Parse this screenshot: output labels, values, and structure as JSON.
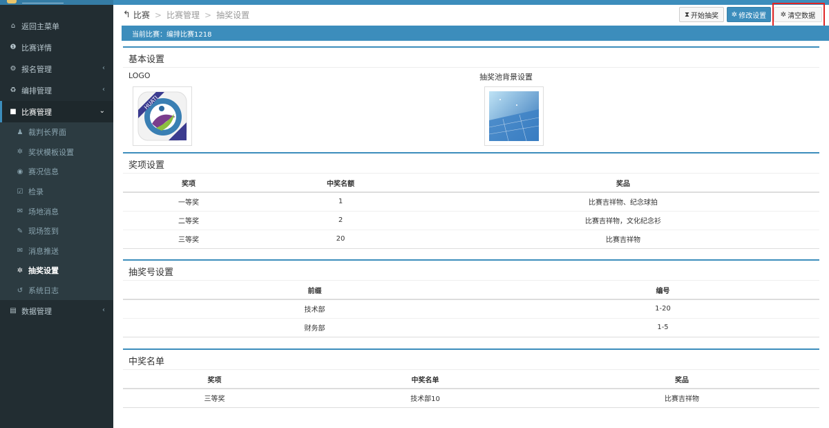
{
  "sidebar": {
    "items": [
      {
        "label": "返回主菜单",
        "icon": "home-icon",
        "glyph": "⌂"
      },
      {
        "label": "比赛详情",
        "icon": "info-icon",
        "glyph": "❶"
      },
      {
        "label": "报名管理",
        "icon": "cogs-icon",
        "glyph": "⚙"
      },
      {
        "label": "编排管理",
        "icon": "recycle-icon",
        "glyph": "♻"
      },
      {
        "label": "比赛管理",
        "icon": "square-icon",
        "glyph": "■"
      }
    ],
    "sub_items": [
      {
        "label": "裁判长界面",
        "icon": "user-icon",
        "glyph": "♟"
      },
      {
        "label": "奖状模板设置",
        "icon": "gear-icon",
        "glyph": "✲"
      },
      {
        "label": "赛况信息",
        "icon": "eye-icon",
        "glyph": "◉"
      },
      {
        "label": "检录",
        "icon": "checkbox-icon",
        "glyph": "☑"
      },
      {
        "label": "场地消息",
        "icon": "comments-icon",
        "glyph": "✉"
      },
      {
        "label": "现场签到",
        "icon": "edit-icon",
        "glyph": "✎"
      },
      {
        "label": "消息推送",
        "icon": "comments-icon",
        "glyph": "✉"
      },
      {
        "label": "抽奖设置",
        "icon": "gear-icon",
        "glyph": "✲"
      },
      {
        "label": "系统日志",
        "icon": "history-icon",
        "glyph": "↺"
      }
    ],
    "last_item": {
      "label": "数据管理",
      "icon": "database-icon",
      "glyph": "▤"
    }
  },
  "breadcrumb": {
    "root": "比赛",
    "middle": "比赛管理",
    "current": "抽奖设置"
  },
  "toolbar": {
    "start": "开始抽奖",
    "modify": "修改设置",
    "clear": "清空数据"
  },
  "banner": "当前比赛：编排比赛1218",
  "basic": {
    "title": "基本设置",
    "logo_label": "LOGO",
    "logo_text": "HUATI",
    "bg_label": "抽奖池背景设置"
  },
  "prizes": {
    "title": "奖项设置",
    "headers": [
      "奖项",
      "中奖名额",
      "奖品"
    ],
    "rows": [
      [
        "一等奖",
        "1",
        "比赛吉祥物、纪念球拍"
      ],
      [
        "二等奖",
        "2",
        "比赛吉祥物，文化纪念衫"
      ],
      [
        "三等奖",
        "20",
        "比赛吉祥物"
      ]
    ]
  },
  "numbers": {
    "title": "抽奖号设置",
    "headers": [
      "前缀",
      "编号"
    ],
    "rows": [
      [
        "技术部",
        "1-20"
      ],
      [
        "财务部",
        "1-5"
      ]
    ]
  },
  "winners": {
    "title": "中奖名单",
    "headers": [
      "奖项",
      "中奖名单",
      "奖品"
    ],
    "rows": [
      [
        "三等奖",
        "技术部10",
        "比赛吉祥物"
      ]
    ]
  },
  "colors": {
    "primary": "#3c8dbc",
    "sidebar": "#222d32",
    "highlight": "#e02424"
  }
}
